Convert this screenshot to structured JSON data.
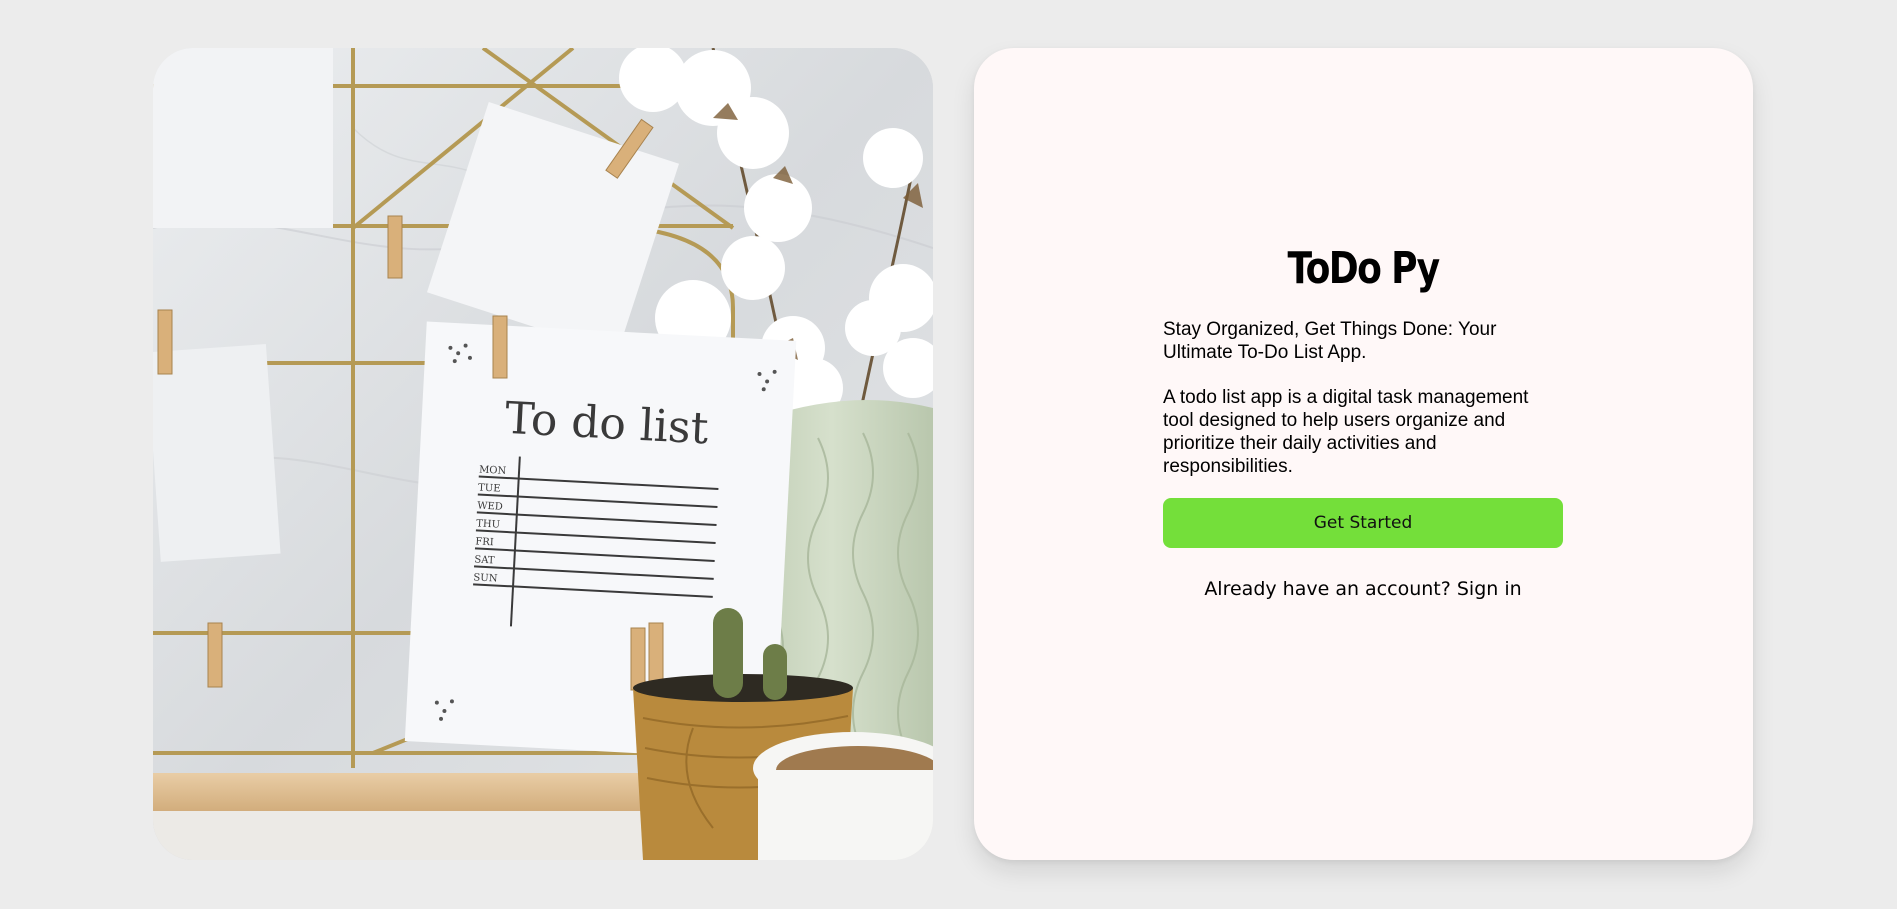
{
  "hero_image": {
    "note_title": "To do list",
    "days": [
      "MON",
      "TUE",
      "WED",
      "THU",
      "FRI",
      "SAT",
      "SUN"
    ]
  },
  "app": {
    "title": "ToDo Py",
    "tagline": "Stay Organized, Get Things Done: Your Ultimate To-Do List App.",
    "description": "A todo list app is a digital task management tool designed to help users organize and prioritize their daily activities and responsibilities.",
    "cta_label": "Get Started",
    "signin_prompt": "Already have an account?",
    "signin_label": "Sign in"
  },
  "colors": {
    "background": "#ececec",
    "card": "#fff8f8",
    "accent": "#74df3a"
  }
}
